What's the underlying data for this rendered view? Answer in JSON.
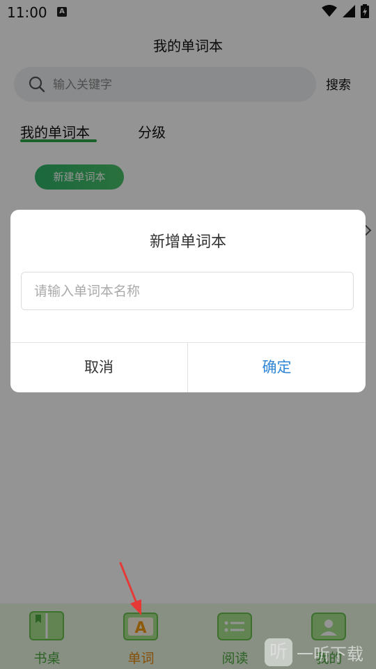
{
  "status_bar": {
    "time": "11:00",
    "notification_glyph": "A"
  },
  "header": {
    "title": "我的单词本"
  },
  "search": {
    "placeholder": "输入关键字",
    "button_label": "搜索"
  },
  "tabs": [
    {
      "label": "我的单词本",
      "active": true
    },
    {
      "label": "分级",
      "active": false
    }
  ],
  "new_book_button": {
    "label": "新建单词本"
  },
  "dialog": {
    "title": "新增单词本",
    "input_placeholder": "请输入单词本名称",
    "cancel_label": "取消",
    "confirm_label": "确定",
    "confirm_color": "#2f86d6"
  },
  "bottom_nav": [
    {
      "label": "书桌",
      "icon": "book-icon",
      "active": false
    },
    {
      "label": "单词",
      "icon": "letter-a-icon",
      "active": true
    },
    {
      "label": "阅读",
      "icon": "list-icon",
      "active": false
    },
    {
      "label": "我的",
      "icon": "profile-icon",
      "active": false
    }
  ],
  "watermark": {
    "glyph": "听",
    "text": "一听下载"
  },
  "colors": {
    "accent_green": "#2fa84a",
    "nav_active": "#e88a12",
    "nav_inactive": "#4caa3e",
    "annotation_red": "#e53935"
  }
}
